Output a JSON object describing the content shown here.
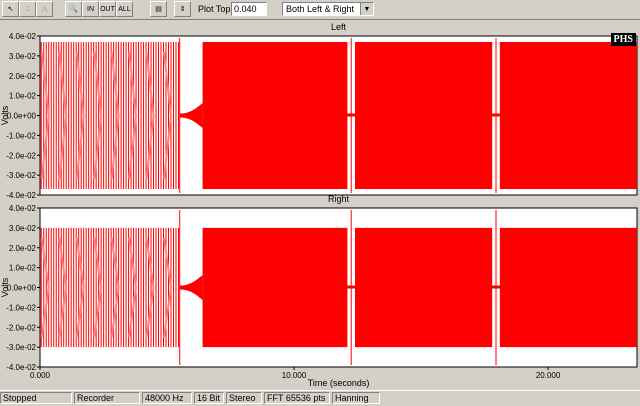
{
  "toolbar": {
    "buttons": [
      {
        "name": "pointer-tool-button",
        "icon": "arrow-pointer-icon",
        "glyph": "↖",
        "enabled": true
      },
      {
        "name": "cursor-tool-button",
        "icon": "cursor-icon",
        "glyph": "⌶",
        "enabled": false
      },
      {
        "name": "marker-tool-button",
        "icon": "marker-icon",
        "glyph": "⋀",
        "enabled": false
      },
      {
        "name": "zoom-button",
        "icon": "magnifier-icon",
        "glyph": "🔍",
        "enabled": true
      },
      {
        "name": "zoom-in-button",
        "icon": "zoom-in-icon",
        "glyph": "IN",
        "enabled": true
      },
      {
        "name": "zoom-out-button",
        "icon": "zoom-out-icon",
        "glyph": "OUT",
        "enabled": true
      },
      {
        "name": "zoom-all-button",
        "icon": "zoom-all-icon",
        "glyph": "ALL",
        "enabled": true
      },
      {
        "name": "display-settings-button",
        "icon": "display-icon",
        "glyph": "▤",
        "enabled": true
      },
      {
        "name": "vertical-scale-button",
        "icon": "vertical-scale-icon",
        "glyph": "⇕",
        "enabled": true
      }
    ],
    "plot_top_label": "Plot Top:",
    "plot_top_value": "0.040",
    "channel_select": "Both Left & Right"
  },
  "logo": "PHS",
  "colors": {
    "signal": "#ff0000",
    "plot_bg": "#ffffff",
    "panel": "#d4d0c8",
    "grid": "#a0a0a0"
  },
  "chart_data": [
    {
      "type": "line",
      "title": "Left",
      "ylabel": "Volts",
      "ylim": [
        -0.04,
        0.04
      ],
      "yticks": [
        "4.0e-02",
        "3.0e-02",
        "2.0e-02",
        "1.0e-02",
        "0.0e+00",
        "-1.0e-02",
        "-2.0e-02",
        "-3.0e-02",
        "-4.0e-02"
      ],
      "xlim": [
        0,
        23.5
      ],
      "segments": [
        {
          "x": [
            0.0,
            5.5
          ],
          "amplitude": 0.037,
          "pattern": "pulsed"
        },
        {
          "x": [
            5.5,
            6.4
          ],
          "amplitude": 0.004,
          "pattern": "transition"
        },
        {
          "x": [
            6.4,
            12.1
          ],
          "amplitude": 0.037,
          "pattern": "continuous"
        },
        {
          "x": [
            12.4,
            17.8
          ],
          "amplitude": 0.037,
          "pattern": "continuous"
        },
        {
          "x": [
            18.1,
            23.5
          ],
          "amplitude": 0.037,
          "pattern": "continuous"
        }
      ]
    },
    {
      "type": "line",
      "title": "Right",
      "xlabel": "Time (seconds)",
      "ylabel": "Volts",
      "ylim": [
        -0.04,
        0.04
      ],
      "yticks": [
        "4.0e-02",
        "3.0e-02",
        "2.0e-02",
        "1.0e-02",
        "0.0e+00",
        "-1.0e-02",
        "-2.0e-02",
        "-3.0e-02",
        "-4.0e-02"
      ],
      "xlim": [
        0,
        23.5
      ],
      "xticks": [
        {
          "x": 0,
          "label": "0.000"
        },
        {
          "x": 10,
          "label": "10.000"
        },
        {
          "x": 20,
          "label": "20.000"
        }
      ],
      "segments": [
        {
          "x": [
            0.0,
            5.5
          ],
          "amplitude": 0.03,
          "pattern": "pulsed"
        },
        {
          "x": [
            5.5,
            6.4
          ],
          "amplitude": 0.004,
          "pattern": "transition"
        },
        {
          "x": [
            6.4,
            12.1
          ],
          "amplitude": 0.03,
          "pattern": "continuous"
        },
        {
          "x": [
            12.4,
            17.8
          ],
          "amplitude": 0.03,
          "pattern": "continuous"
        },
        {
          "x": [
            18.1,
            23.5
          ],
          "amplitude": 0.03,
          "pattern": "continuous"
        }
      ]
    }
  ],
  "status": [
    "Stopped",
    "Recorder",
    "48000 Hz",
    "16 Bit",
    "Stereo",
    "FFT 65536 pts",
    "Hanning"
  ]
}
